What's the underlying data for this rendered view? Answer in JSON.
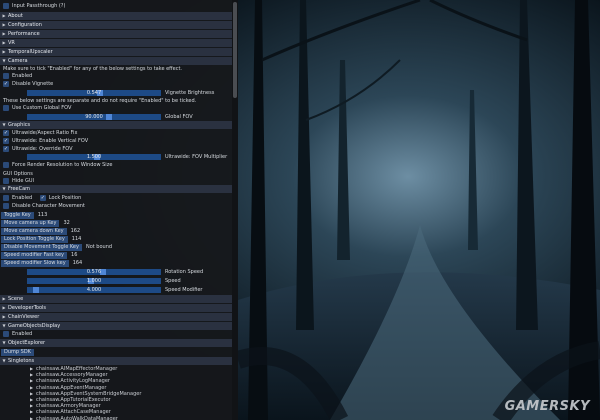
{
  "sections_top": [
    {
      "label": "Input Passthrough  (?)",
      "type": "text"
    },
    {
      "label": "About",
      "type": "header"
    },
    {
      "label": "Configuration",
      "type": "header"
    },
    {
      "label": "Performance",
      "type": "header"
    },
    {
      "label": "VR",
      "type": "header"
    },
    {
      "label": "TemporalUpscaler",
      "type": "header"
    }
  ],
  "camera": {
    "header": "Camera",
    "note": "Make sure to tick \"Enabled\" for any of the below settings to take effect.",
    "enabled": "Enabled",
    "disable_vignette": "Disable Vignette",
    "vignette_value": "0.547",
    "vignette_label": "Vignette Brightness",
    "vignette_fraction": 0.55,
    "note2": "These below settings are separate and do not require \"Enabled\" to be ticked.",
    "custom_fov": "Use Custom Global FOV",
    "global_fov_value": "90.000",
    "global_fov_label": "Global FOV",
    "global_fov_fraction": 0.62
  },
  "graphics": {
    "header": "Graphics",
    "aspect": "Ultrawide/Aspect Ratio Fix",
    "vertical_fov": "Ultrawide: Enable Vertical FOV",
    "override_fov": "Ultrawide: Override FOV",
    "fov_mult_value": "1.500",
    "fov_mult_label": "Ultrawide: FOV Multiplier",
    "fov_mult_fraction": 0.52,
    "force_render": "Force Render Resolution to Window Size"
  },
  "gui": {
    "label": "GUI Options",
    "hide": "Hide GUI"
  },
  "freecam": {
    "header": "FreeCam",
    "enabled": "Enabled",
    "lock_position": "Lock Position",
    "disable_movement": "Disable Character Movement",
    "toggle_key": "Toggle Key",
    "toggle_key_val": "113",
    "move_up": "Move camera up Key",
    "move_up_val": "32",
    "move_down": "Move camera down Key",
    "move_down_val": "162",
    "lock_toggle": "Lock Position Toggle Key",
    "lock_toggle_val": "114",
    "disable_toggle": "Disable Movement Toggle Key",
    "disable_toggle_val": "Not bound",
    "fast_key": "Speed modifier Fast key",
    "fast_key_val": "16",
    "slow_key": "Speed modifier Slow key",
    "slow_key_val": "164",
    "rot_speed_value": "0.576",
    "rot_speed_label": "Rotation Speed",
    "rot_speed_fraction": 0.57,
    "speed_value": "1.000",
    "speed_label": "Speed",
    "speed_fraction": 0.48,
    "speed_mod_value": "4.000",
    "speed_mod_label": "Speed Modifier",
    "speed_mod_fraction": 0.05
  },
  "sections_mid": {
    "scene": "Scene",
    "dev_tools": "DeveloperTools",
    "chain_viewer": "ChainViewer",
    "game_objects": "GameObjectsDisplay",
    "game_objects_enabled": "Enabled",
    "object_explorer": "ObjectExplorer",
    "dump_sdk": "Dump SDK",
    "singletons": "Singletons"
  },
  "singletons": [
    "chainsaw.AIMapEffectorManager",
    "chainsaw.AccessoryManager",
    "chainsaw.ActivityLogManager",
    "chainsaw.AppEventManager",
    "chainsaw.AppEventSystemBridgeManager",
    "chainsaw.AppTutorialExecutor",
    "chainsaw.ArmoryManager",
    "chainsaw.AttachCaseManager",
    "chainsaw.AutoWalkDataManager"
  ],
  "watermark": "GAMERSKY",
  "colors": {
    "panel": "#16181b",
    "header": "#2a3140",
    "accent": "#2b4a78",
    "slider_grab": "#4f86d6"
  }
}
